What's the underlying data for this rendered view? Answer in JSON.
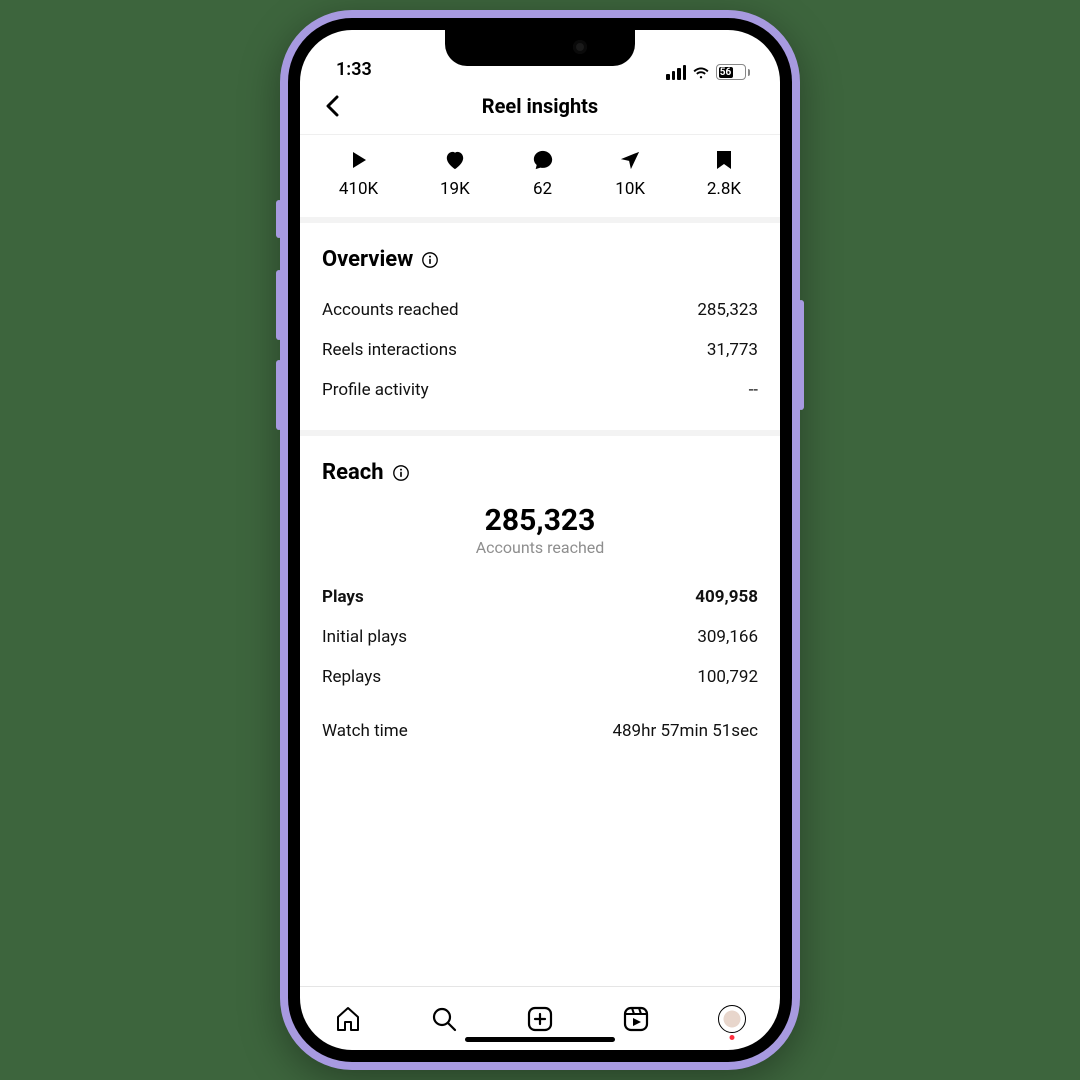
{
  "status": {
    "time": "1:33",
    "battery_pct": "56"
  },
  "header": {
    "title": "Reel insights"
  },
  "stats": {
    "plays": "410K",
    "likes": "19K",
    "comments": "62",
    "shares": "10K",
    "saves": "2.8K"
  },
  "overview": {
    "title": "Overview",
    "rows": {
      "accounts_reached": {
        "label": "Accounts reached",
        "value": "285,323"
      },
      "reels_interactions": {
        "label": "Reels interactions",
        "value": "31,773"
      },
      "profile_activity": {
        "label": "Profile activity",
        "value": "--"
      }
    }
  },
  "reach": {
    "title": "Reach",
    "hero_value": "285,323",
    "hero_label": "Accounts reached",
    "plays": {
      "label": "Plays",
      "value": "409,958"
    },
    "initial_plays": {
      "label": "Initial plays",
      "value": "309,166"
    },
    "replays": {
      "label": "Replays",
      "value": "100,792"
    },
    "watch_time": {
      "label": "Watch time",
      "value": "489hr 57min 51sec"
    }
  }
}
